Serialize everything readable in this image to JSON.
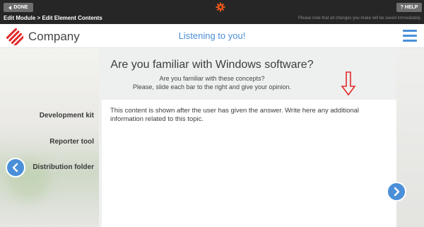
{
  "toolbar": {
    "done_label": "DONE",
    "help_label": "HELP",
    "gear_icon": "gear-icon",
    "accent": "#e8561b"
  },
  "breadcrumb": {
    "text": "Edit Module > Edit Element Contents",
    "notice": "Please note that all changes you make will be saved immediately."
  },
  "header": {
    "company": "Company",
    "status": "Listening to you!",
    "brand_color": "#e02a2a",
    "accent_color": "#4a8fd8"
  },
  "question": {
    "title": "Are you familiar with Windows software?",
    "line1": "Are you familiar with these concepts?",
    "line2": "Please, slide each bar to the right  and give your opinion."
  },
  "items": [
    {
      "label": "Development kit"
    },
    {
      "label": "Reporter tool"
    },
    {
      "label": "Distribution folder"
    }
  ],
  "feedback": {
    "text": "This content is shown after the user has given the answer. Write here any additional information related to this topic."
  },
  "annotation": {
    "arrow_color": "#e02a2a"
  }
}
